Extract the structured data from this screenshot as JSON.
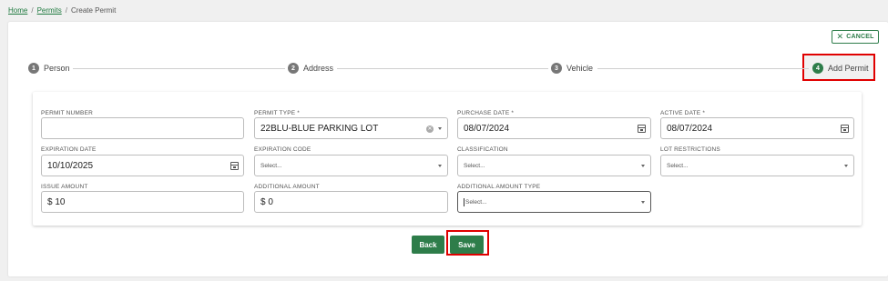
{
  "breadcrumb": {
    "home": "Home",
    "separator": "/",
    "permits": "Permits",
    "current": "Create Permit"
  },
  "cancel_button": {
    "label": "CANCEL",
    "icon": "close-icon"
  },
  "stepper": {
    "steps": [
      {
        "num": "1",
        "label": "Person",
        "active": false
      },
      {
        "num": "2",
        "label": "Address",
        "active": false
      },
      {
        "num": "3",
        "label": "Vehicle",
        "active": false
      },
      {
        "num": "4",
        "label": "Add Permit",
        "active": true
      }
    ]
  },
  "form": {
    "permit_number": {
      "label": "PERMIT NUMBER",
      "value": ""
    },
    "permit_type": {
      "label": "PERMIT TYPE *",
      "value": "22BLU-BLUE PARKING LOT"
    },
    "purchase_date": {
      "label": "PURCHASE DATE *",
      "value": "08/07/2024"
    },
    "active_date": {
      "label": "ACTIVE DATE *",
      "value": "08/07/2024"
    },
    "expiration_date": {
      "label": "EXPIRATION DATE",
      "value": "10/10/2025"
    },
    "expiration_code": {
      "label": "EXPIRATION CODE",
      "value": "Select..."
    },
    "classification": {
      "label": "CLASSIFICATION",
      "value": "Select..."
    },
    "lot_restrictions": {
      "label": "LOT RESTRICTIONS",
      "value": "Select..."
    },
    "issue_amount": {
      "label": "ISSUE AMOUNT",
      "value": "$ 10"
    },
    "additional_amount": {
      "label": "ADDITIONAL AMOUNT",
      "value": "$ 0"
    },
    "additional_amount_type": {
      "label": "ADDITIONAL AMOUNT TYPE",
      "value": "Select..."
    }
  },
  "actions": {
    "back": "Back",
    "save": "Save"
  },
  "colors": {
    "accent": "#2e7d4a",
    "highlight": "#e00000",
    "link": "#1f7a3f"
  }
}
